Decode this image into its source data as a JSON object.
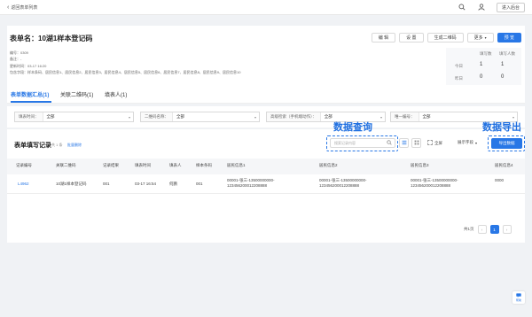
{
  "topbar": {
    "back_label": "返回表单列表",
    "enter_admin": "进入后台"
  },
  "form": {
    "title": "表单名：10湖1样本登记码",
    "meta": {
      "number": "编号：0309",
      "remark": "备注：-",
      "updated": "更新时间：03-17 16:20",
      "includes": "包含字段：样本条码、居民信息1、居民信息2、居民信息3、居民信息4、居民信息5、居民信息6、居民信息7、居民信息8、居民信息9、居民信息10"
    },
    "actions": {
      "edit": "编 辑",
      "settings": "设 置",
      "gen_qr": "生成二维码",
      "more": "更多",
      "preview": "预 览"
    },
    "stats": {
      "col_filled": "填写数",
      "col_people": "填写人数",
      "rows": [
        {
          "label": "今日",
          "filled": "1",
          "people": "1"
        },
        {
          "label": "昨日",
          "filled": "0",
          "people": "0"
        }
      ]
    }
  },
  "tabs": [
    {
      "label": "表单数据汇总(1)"
    },
    {
      "label": "关联二维码(1)"
    },
    {
      "label": "填表人(1)"
    }
  ],
  "filters": [
    {
      "label": "填表时间：",
      "value": "全部"
    },
    {
      "label": "二维码名称：",
      "value": "全部"
    },
    {
      "label": "高级检索（手机端动作）：",
      "value": "全部"
    },
    {
      "label": "唯一编号：",
      "value": "全部"
    }
  ],
  "records": {
    "title": "表单填写记录",
    "count": "共 1 条",
    "batch_delete": "批量删除",
    "search_placeholder": "搜索记录内容",
    "fullscreen": "全屏",
    "show_fields": "展示字段",
    "export": "导出数据",
    "annotation_search": "数据查询",
    "annotation_export": "数据导出",
    "columns": [
      "记录编号",
      "关联二维码",
      "记录结果",
      "填表时间",
      "填表人",
      "样本条码",
      "居民信息1",
      "居民信息2",
      "居民信息3",
      "居民信息4"
    ],
    "row": {
      "id": "L4962",
      "qr": "10湖1样本登记码",
      "result": "001",
      "time": "03-17 16:54",
      "filler": "何鹏",
      "sample": "001",
      "info1_l1": "00001-张三-13500000000-",
      "info1_l2": "123456200012208888",
      "info2_l1": "00001-张三-13500000000-",
      "info2_l2": "123456200012208888",
      "info3_l1": "00001-张三-13500000000-",
      "info3_l2": "123456200012208888",
      "info4_l1": "0000"
    },
    "pager": {
      "total": "共1页",
      "current": "1"
    }
  },
  "help": "帮助",
  "colors": {
    "primary": "#2877e6",
    "background": "#f0f2f5"
  }
}
